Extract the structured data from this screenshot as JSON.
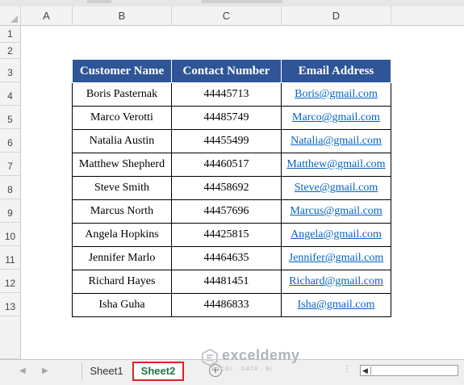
{
  "columns": [
    "A",
    "B",
    "C",
    "D"
  ],
  "rows": [
    "1",
    "2",
    "3",
    "4",
    "5",
    "6",
    "7",
    "8",
    "9",
    "10",
    "11",
    "12",
    "13"
  ],
  "table": {
    "headers": [
      "Customer Name",
      "Contact Number",
      "Email Address"
    ],
    "rows": [
      [
        "Boris Pasternak",
        "44445713",
        "Boris@gmail.com"
      ],
      [
        "Marco Verotti",
        "44485749",
        "Marco@gmail.com"
      ],
      [
        "Natalia Austin",
        "44455499",
        "Natalia@gmail.com"
      ],
      [
        "Matthew Shepherd",
        "44460517",
        "Matthew@gmail.com"
      ],
      [
        "Steve Smith",
        "44458692",
        "Steve@gmail.com"
      ],
      [
        "Marcus North",
        "44457696",
        "Marcus@gmail.com"
      ],
      [
        "Angela Hopkins",
        "44425815",
        "Angela@gmail.com"
      ],
      [
        "Jennifer Marlo",
        "44464635",
        "Jennifer@gmail.com"
      ],
      [
        "Richard Hayes",
        "44481451",
        "Richard@gmail.com"
      ],
      [
        "Isha Guha",
        "44486833",
        "Isha@gmail.com"
      ]
    ]
  },
  "sheets": {
    "tab1": "Sheet1",
    "tab2": "Sheet2",
    "active": "Sheet2",
    "add_label": "+"
  },
  "watermark": {
    "name": "exceldemy",
    "tagline": "EXCEL · DATA · BI"
  },
  "colors": {
    "header_bg": "#2f5597",
    "link": "#0563c1",
    "active_tab_border": "#e02020",
    "active_tab_text": "#217346"
  },
  "icons": {
    "nav_prev": "◀",
    "nav_next": "▶",
    "scroll_left": "◀",
    "separator": "⋮"
  }
}
